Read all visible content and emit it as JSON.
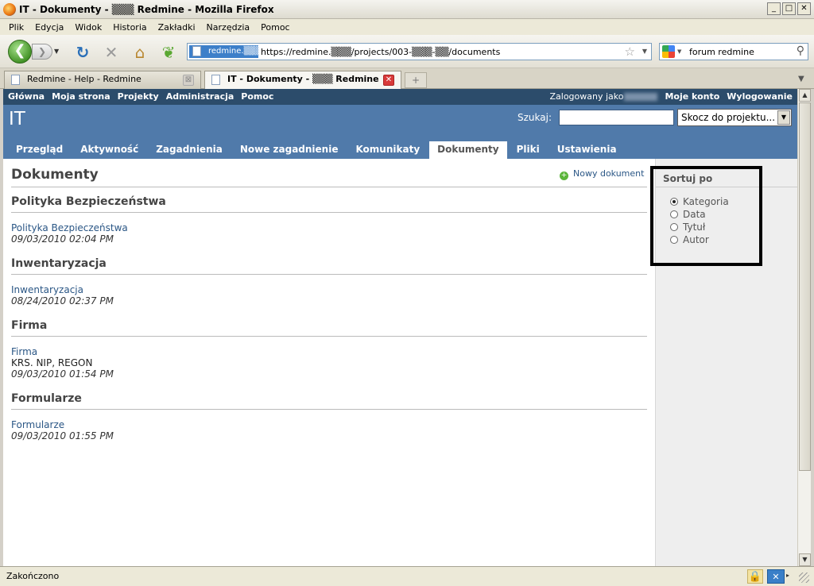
{
  "window": {
    "title": "IT - Dokumenty - ▒▒▒ Redmine - Mozilla Firefox",
    "buttons": {
      "minimize": "_",
      "maximize": "□",
      "close": "✕"
    }
  },
  "menu": [
    "Plik",
    "Edycja",
    "Widok",
    "Historia",
    "Zakładki",
    "Narzędzia",
    "Pomoc"
  ],
  "navbar": {
    "back_glyph": "❮",
    "forward_glyph": "❯",
    "dropdown_glyph": "▼",
    "reload_glyph": "↻",
    "stop_glyph": "✕",
    "home_glyph": "⌂",
    "leaf_glyph": "❦",
    "url_site_label": "redmine.▒▒▒",
    "url": "https://redmine.▒▒▒/projects/003-▒▒▒-▒▒/documents",
    "bookmark_glyph": "☆",
    "search_text": "forum redmine",
    "search_go_glyph": "⚲"
  },
  "tabs": {
    "items": [
      {
        "label": "Redmine - Help - Redmine",
        "close": "⊠"
      },
      {
        "label": "IT - Dokumenty - ▒▒▒ Redmine",
        "close": "✕"
      }
    ],
    "new_tab": "+",
    "list_glyph": "▼"
  },
  "redmine": {
    "top_menu": [
      "Główna",
      "Moja strona",
      "Projekty",
      "Administracja",
      "Pomoc"
    ],
    "logged_in_as": "Zalogowany jako",
    "my_account": "Moje konto",
    "logout": "Wylogowanie",
    "project_title": "IT",
    "search_label": "Szukaj:",
    "jump_to_project": "Skocz do projektu...",
    "jump_arrow": "▼",
    "main_menu": [
      "Przegląd",
      "Aktywność",
      "Zagadnienia",
      "Nowe zagadnienie",
      "Komunikaty",
      "Dokumenty",
      "Pliki",
      "Ustawienia"
    ],
    "selected_tab": "Dokumenty",
    "page_title": "Dokumenty",
    "new_document": "Nowy dokument",
    "add_glyph": "+",
    "categories": [
      {
        "name": "Polityka Bezpieczeństwa",
        "doc": "Polityka Bezpieczeństwa",
        "desc": "",
        "date": "09/03/2010 02:04 PM"
      },
      {
        "name": "Inwentaryzacja",
        "doc": "Inwentaryzacja",
        "desc": "",
        "date": "08/24/2010 02:37 PM"
      },
      {
        "name": "Firma",
        "doc": "Firma",
        "desc": "KRS. NIP, REGON",
        "date": "09/03/2010 01:54 PM"
      },
      {
        "name": "Formularze",
        "doc": "Formularze",
        "desc": "",
        "date": "09/03/2010 01:55 PM"
      }
    ],
    "sidebar": {
      "title": "Sortuj po",
      "options": [
        "Kategoria",
        "Data",
        "Tytuł",
        "Autor"
      ],
      "selected": "Kategoria"
    }
  },
  "scrollbar": {
    "up": "▲",
    "down": "▼"
  },
  "status": {
    "text": "Zakończono",
    "lock_glyph": "🔒",
    "addon_glyph": "✕",
    "addon_drop": "▸"
  }
}
